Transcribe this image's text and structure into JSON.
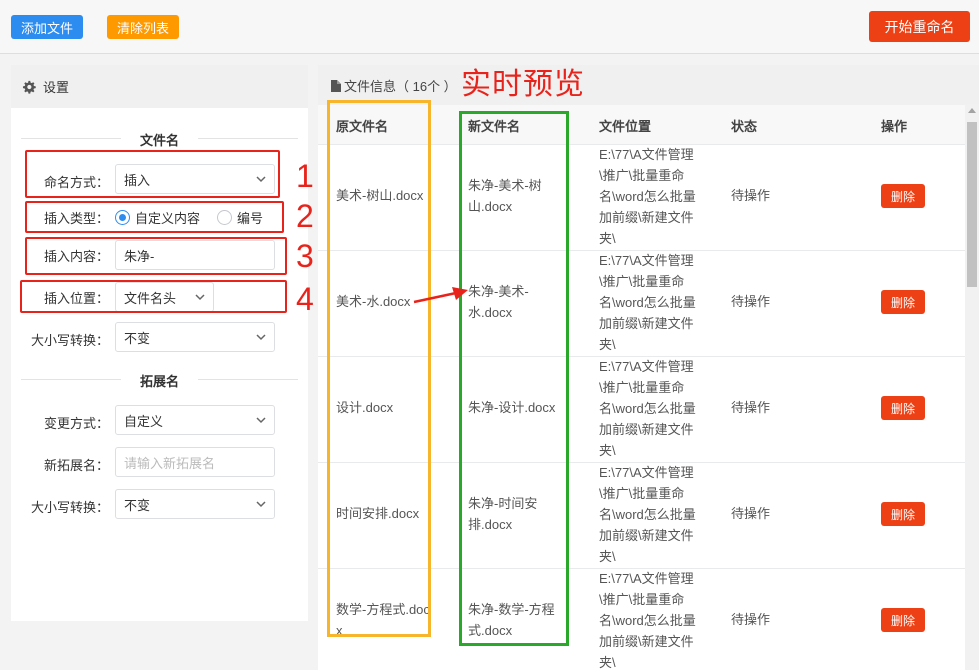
{
  "toolbar": {
    "add_label": "添加文件",
    "clear_label": "清除列表",
    "start_label": "开始重命名"
  },
  "settings": {
    "title": "设置",
    "filename_section": "文件名",
    "naming_mode_label": "命名方式：",
    "naming_mode_value": "插入",
    "insert_type_label": "插入类型：",
    "insert_type_options": [
      "自定义内容",
      "编号"
    ],
    "insert_content_label": "插入内容：",
    "insert_content_value": "朱净-",
    "insert_position_label": "插入位置：",
    "insert_position_value": "文件名头",
    "case_label": "大小写转换：",
    "case_value": "不变",
    "ext_section": "拓展名",
    "ext_change_label": "变更方式：",
    "ext_change_value": "自定义",
    "new_ext_label": "新拓展名：",
    "new_ext_placeholder": "请输入新拓展名",
    "ext_case_label": "大小写转换：",
    "ext_case_value": "不变"
  },
  "annotations": {
    "numbers": [
      "1",
      "2",
      "3",
      "4"
    ],
    "preview": "实时预览",
    "colors": {
      "red": "#e8231b",
      "yellow": "#f7b52c",
      "green": "#2aa82a"
    }
  },
  "file_info": {
    "title": "文件信息（ 16个 ）",
    "columns": [
      "原文件名",
      "新文件名",
      "文件位置",
      "状态",
      "操作"
    ],
    "rows": [
      {
        "original": "美术-树山.docx",
        "new": "朱净-美术-树山.docx",
        "location": "E:\\77\\A文件管理\\推广\\批量重命名\\word怎么批量加前缀\\新建文件夹\\",
        "status": "待操作",
        "action": "删除"
      },
      {
        "original": "美术-水.docx",
        "new": "朱净-美术-水.docx",
        "location": "E:\\77\\A文件管理\\推广\\批量重命名\\word怎么批量加前缀\\新建文件夹\\",
        "status": "待操作",
        "action": "删除"
      },
      {
        "original": "设计.docx",
        "new": "朱净-设计.docx",
        "location": "E:\\77\\A文件管理\\推广\\批量重命名\\word怎么批量加前缀\\新建文件夹\\",
        "status": "待操作",
        "action": "删除"
      },
      {
        "original": "时间安排.docx",
        "new": "朱净-时间安排.docx",
        "location": "E:\\77\\A文件管理\\推广\\批量重命名\\word怎么批量加前缀\\新建文件夹\\",
        "status": "待操作",
        "action": "删除"
      },
      {
        "original": "数学-方程式.docx",
        "new": "朱净-数学-方程式.docx",
        "location": "E:\\77\\A文件管理\\推广\\批量重命名\\word怎么批量加前缀\\新建文件夹\\",
        "status": "待操作",
        "action": "删除"
      }
    ]
  }
}
